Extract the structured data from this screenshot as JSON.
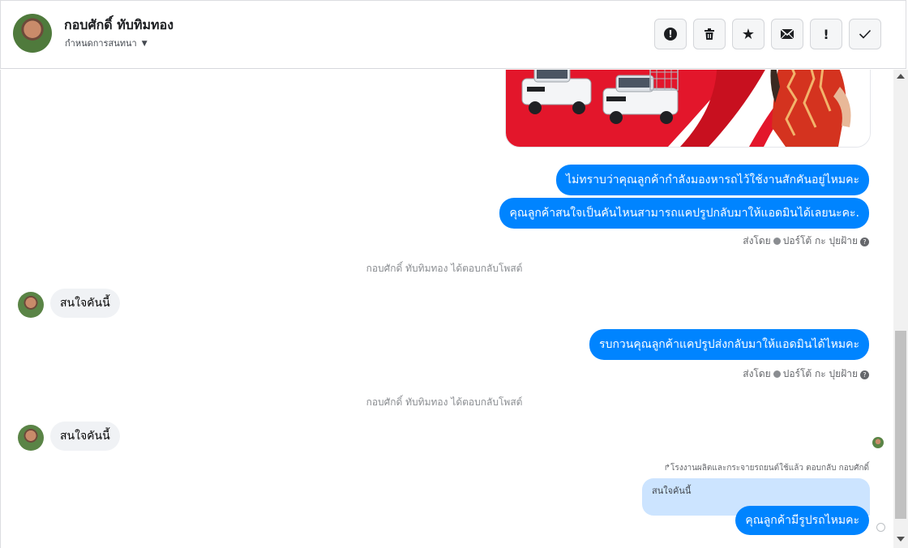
{
  "header": {
    "name": "กอบศักดิ์ ทับทิมทอง",
    "subtitle": "กำหนดการสนทนา",
    "actions": [
      {
        "icon": "alert-circle-icon",
        "glyph": "!"
      },
      {
        "icon": "trash-icon",
        "glyph": "🗑"
      },
      {
        "icon": "star-icon",
        "glyph": "★"
      },
      {
        "icon": "envelope-icon",
        "glyph": "✉"
      },
      {
        "icon": "exclamation-icon",
        "glyph": "!"
      },
      {
        "icon": "check-icon",
        "glyph": "✓"
      }
    ]
  },
  "messages": {
    "out_1": "ไม่ทราบว่าคุณลูกค้ากำลังมองหารถไว้ใช้งานสักคันอยู่ไหมคะ",
    "out_2": "คุณลูกค้าสนใจเป็นคันไหนสามารถแคปรูปกลับมาให้แอดมินได้เลยนะคะ.",
    "sent_by_prefix": "ส่งโดย",
    "sent_by_name": "ปอร์โต้ กะ ปุยฝ้าย",
    "system_1": "กอบศักดิ์ ทับทิมทอง ได้ตอบกลับโพสต์",
    "in_1": "สนใจคันนี้",
    "out_3": "รบกวนคุณลูกค้าแคปรูปส่งกลับมาให้แอดมินได้ไหมคะ",
    "system_2": "กอบศักดิ์ ทับทิมทอง ได้ตอบกลับโพสต์",
    "in_2": "สนใจคันนี้",
    "reply_label": "↱โรงงานผลิตและกระจายรถยนต์ใช้แล้ว ตอบกลับ กอบศักดิ์",
    "quoted": "สนใจคันนี้",
    "out_4": "คุณลูกค้ามีรูปรถไหมคะ"
  },
  "colors": {
    "accent": "#0084ff",
    "incoming": "#f0f2f5",
    "quoted": "#cce4ff",
    "banner_red": "#e3162b"
  }
}
